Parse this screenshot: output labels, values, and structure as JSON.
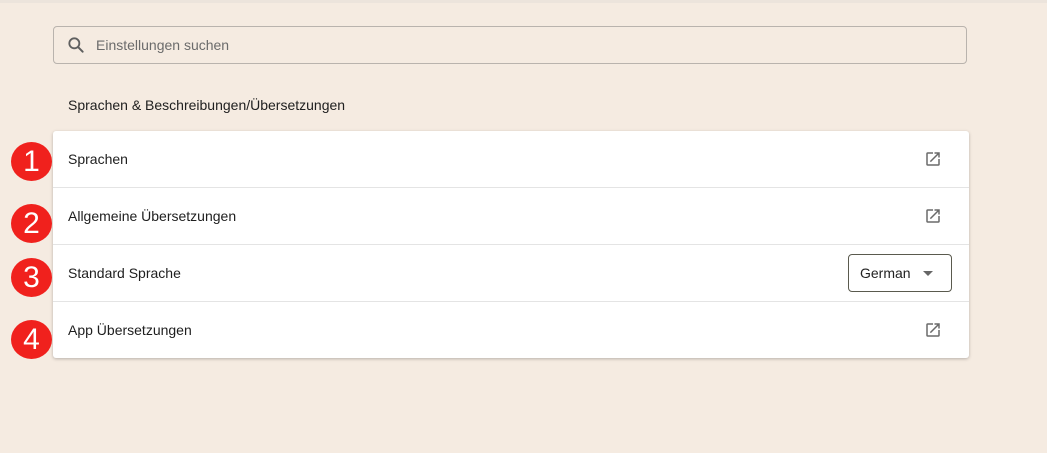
{
  "search": {
    "placeholder": "Einstellungen suchen",
    "icon": "search-icon"
  },
  "section": {
    "title": "Sprachen & Beschreibungen/Übersetzungen"
  },
  "settings": {
    "rows": [
      {
        "label": "Sprachen",
        "action": "open-in-new-icon"
      },
      {
        "label": "Allgemeine Übersetzungen",
        "action": "open-in-new-icon"
      },
      {
        "label": "Standard Sprache",
        "selected": "German"
      },
      {
        "label": "App Übersetzungen",
        "action": "open-in-new-icon"
      }
    ]
  },
  "markers": [
    "1",
    "2",
    "3",
    "4"
  ],
  "colors": {
    "background": "#f5ebe1",
    "marker": "#f0211d",
    "card": "#ffffff"
  }
}
